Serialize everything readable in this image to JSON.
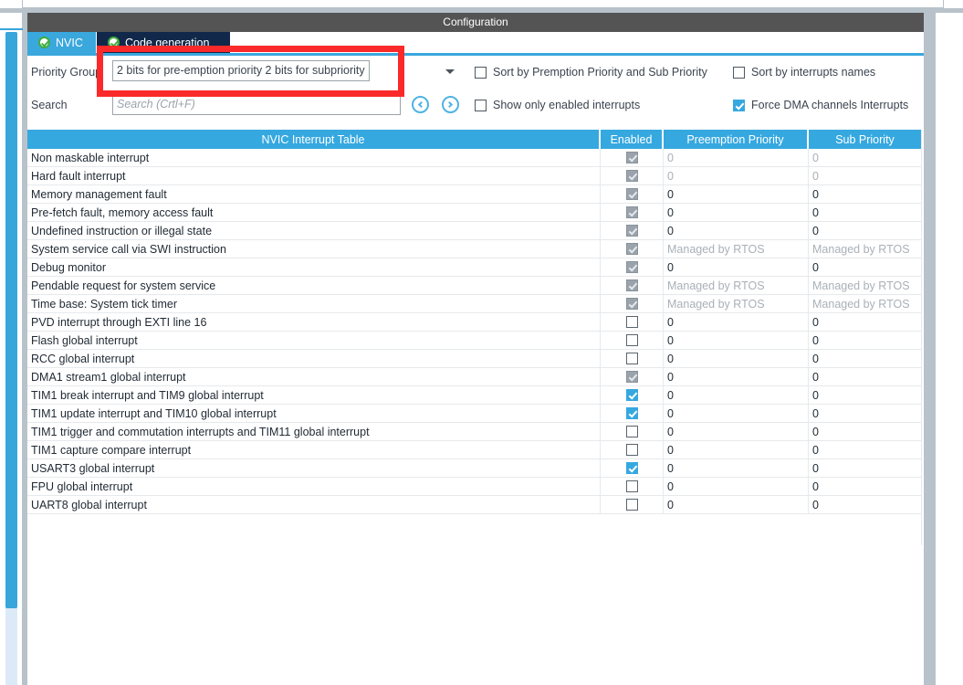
{
  "window": {
    "title": "Configuration"
  },
  "tabs": [
    {
      "label": "NVIC",
      "active": true,
      "icon": "check-circle-icon"
    },
    {
      "label": "Code generation",
      "active": false,
      "icon": "check-circle-icon"
    }
  ],
  "form": {
    "priority_group_label": "Priority Group",
    "priority_group_value": "2 bits for pre-emption priority 2 bits for subpriority",
    "search_label": "Search",
    "search_value": "",
    "search_placeholder": "Search (Crtl+F)",
    "prev_label": "‹",
    "next_label": "›"
  },
  "options": [
    {
      "label": "Sort by Premption Priority and Sub Priority",
      "checked": false
    },
    {
      "label": "Sort by interrupts names",
      "checked": false
    },
    {
      "label": "Show only enabled interrupts",
      "checked": false
    },
    {
      "label": "Force DMA channels Interrupts",
      "checked": true
    }
  ],
  "table": {
    "headers": [
      "NVIC Interrupt Table",
      "Enabled",
      "Preemption Priority",
      "Sub Priority"
    ],
    "rows": [
      {
        "name": "Non maskable interrupt",
        "enabled": "locked",
        "preemption": "0",
        "sub": "0",
        "muted": true
      },
      {
        "name": "Hard fault interrupt",
        "enabled": "locked",
        "preemption": "0",
        "sub": "0",
        "muted": true
      },
      {
        "name": "Memory management fault",
        "enabled": "locked",
        "preemption": "0",
        "sub": "0",
        "muted": false
      },
      {
        "name": "Pre-fetch fault, memory access fault",
        "enabled": "locked",
        "preemption": "0",
        "sub": "0",
        "muted": false
      },
      {
        "name": "Undefined instruction or illegal state",
        "enabled": "locked",
        "preemption": "0",
        "sub": "0",
        "muted": false
      },
      {
        "name": "System service call via SWI instruction",
        "enabled": "locked",
        "preemption": "Managed by RTOS",
        "sub": "Managed by RTOS",
        "muted": true
      },
      {
        "name": "Debug monitor",
        "enabled": "locked",
        "preemption": "0",
        "sub": "0",
        "muted": false
      },
      {
        "name": "Pendable request for system service",
        "enabled": "locked",
        "preemption": "Managed by RTOS",
        "sub": "Managed by RTOS",
        "muted": true
      },
      {
        "name": "Time base: System tick timer",
        "enabled": "locked",
        "preemption": "Managed by RTOS",
        "sub": "Managed by RTOS",
        "muted": true
      },
      {
        "name": "PVD interrupt through EXTI line 16",
        "enabled": "off",
        "preemption": "0",
        "sub": "0",
        "muted": false
      },
      {
        "name": "Flash global interrupt",
        "enabled": "off",
        "preemption": "0",
        "sub": "0",
        "muted": false
      },
      {
        "name": "RCC global interrupt",
        "enabled": "off",
        "preemption": "0",
        "sub": "0",
        "muted": false
      },
      {
        "name": "DMA1 stream1 global interrupt",
        "enabled": "locked",
        "preemption": "0",
        "sub": "0",
        "muted": false
      },
      {
        "name": "TIM1 break interrupt and TIM9 global interrupt",
        "enabled": "on",
        "preemption": "0",
        "sub": "0",
        "muted": false
      },
      {
        "name": "TIM1 update interrupt and TIM10 global interrupt",
        "enabled": "on",
        "preemption": "0",
        "sub": "0",
        "muted": false
      },
      {
        "name": "TIM1 trigger and commutation interrupts and TIM11 global interrupt",
        "enabled": "off",
        "preemption": "0",
        "sub": "0",
        "muted": false
      },
      {
        "name": "TIM1 capture compare interrupt",
        "enabled": "off",
        "preemption": "0",
        "sub": "0",
        "muted": false
      },
      {
        "name": "USART3 global interrupt",
        "enabled": "on",
        "preemption": "0",
        "sub": "0",
        "muted": false
      },
      {
        "name": "FPU global interrupt",
        "enabled": "off",
        "preemption": "0",
        "sub": "0",
        "muted": false
      },
      {
        "name": "UART8 global interrupt",
        "enabled": "off",
        "preemption": "0",
        "sub": "0",
        "muted": false
      }
    ]
  },
  "colors": {
    "accent": "#36a8e0",
    "tab_inactive": "#12284a",
    "title_bar": "#545454",
    "annotation": "#fa2a2a",
    "frame": "#b8c2ca"
  }
}
